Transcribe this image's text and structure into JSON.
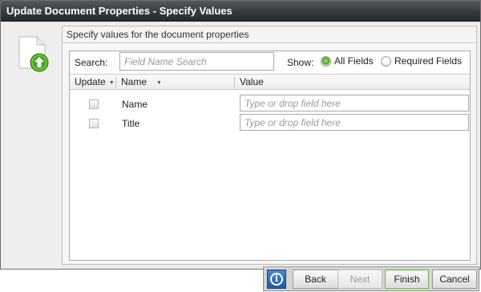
{
  "dialog": {
    "title": "Update Document Properties - Specify Values",
    "icon": "document-upload-icon"
  },
  "panel": {
    "heading": "Specify values for the document properties"
  },
  "search": {
    "label": "Search:",
    "placeholder": "Field Name Search",
    "value": ""
  },
  "show": {
    "label": "Show:",
    "options": [
      {
        "label": "All Fields",
        "selected": true
      },
      {
        "label": "Required Fields",
        "selected": false
      }
    ]
  },
  "grid": {
    "columns": [
      {
        "label": "Update",
        "sortable": true
      },
      {
        "label": "Name",
        "sortable": true
      },
      {
        "label": "Value",
        "sortable": false
      }
    ],
    "rows": [
      {
        "checked": false,
        "name": "Name",
        "value": "",
        "placeholder": "Type or drop field here"
      },
      {
        "checked": false,
        "name": "Title",
        "value": "",
        "placeholder": "Type or drop field here"
      }
    ]
  },
  "buttons": {
    "info_icon": "info-icon",
    "back": "Back",
    "next": "Next",
    "finish": "Finish",
    "cancel": "Cancel"
  },
  "colors": {
    "titlebar": "#383c40",
    "radio_selected": "#3f9b1c",
    "info_button": "#1d5ba6",
    "finish_border": "#79b45a"
  }
}
